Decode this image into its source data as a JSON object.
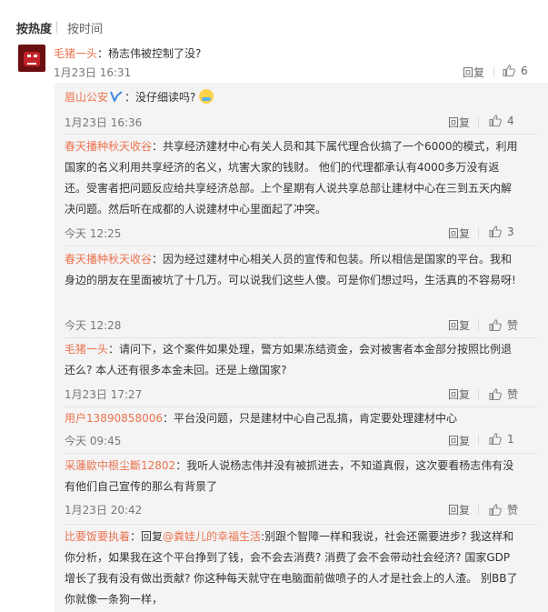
{
  "sort": {
    "hot": "按热度",
    "time": "按时间"
  },
  "top_comment": {
    "user": "毛猪一头",
    "text": "：杨志伟被控制了没?",
    "time": "1月23日 16:31",
    "reply": "回复",
    "likes": "6"
  },
  "replies": [
    {
      "user": "眉山公安",
      "text": "：没仔细读吗?",
      "time": "1月23日 16:36",
      "reply": "回复",
      "likes": "4"
    },
    {
      "user": "春天播种秋天收谷",
      "text": "：共享经济建材中心有关人员和其下属代理合伙搞了一个6000的模式，利用国家的名义利用共享经济的名义，坑害大家的钱财。 他们的代理都承认有4000多万没有返还。受害者把问题反应给共享经济总部。上个星期有人说共享总部让建材中心在三到五天内解决问题。然后听在成都的人说建材中心里面起了冲突。",
      "time": "今天 12:25",
      "reply": "回复",
      "likes": "3"
    },
    {
      "user": "春天播种秋天收谷",
      "text": "：因为经过建材中心相关人员的宣传和包装。所以相信是国家的平台。我和身边的朋友在里面被坑了十几万。可以说我们这些人傻。可是你们想过吗，生活真的不容易呀!",
      "time": "今天 12:28",
      "reply": "回复",
      "likes": "赞"
    },
    {
      "user": "毛猪一头",
      "text": "：请问下，这个案件如果处理，警方如果冻结资金，会对被害者本金部分按照比例退还么? 本人还有很多本金未回。还是上缴国家?",
      "time": "1月23日 17:27",
      "reply": "回复",
      "likes": "赞"
    },
    {
      "user": "用户13890858006",
      "text": "：平台没问题，只是建材中心自己乱搞，肯定要处理建材中心",
      "time": "今天 09:45",
      "reply": "回复",
      "likes": "1"
    },
    {
      "user": "采蓮歐中根尘斷12802",
      "text": "：我听人说杨志伟并没有被抓进去，不知道真假，这次要看杨志伟有没有他们自己宣传的那么有背景了",
      "time": "1月23日 20:42",
      "reply": "回复",
      "likes": "赞"
    },
    {
      "user": "比要饭要执着",
      "text_pre": "：回复",
      "mention": "@粪娃儿的幸福生活",
      "text": ":别跟个智障一样和我说，社会还需要进步?    我这样和你分析，如果我在这个平台挣到了钱，会不会去消费?   消费了会不会带动社会经济?     国家GDP增长了我有没有做出贡献?        你这种每天就守在电脑面前做喷子的人才是社会上的人渣。  别BB了  你就像一条狗一样，",
      "time": "",
      "reply": "",
      "likes": ""
    }
  ]
}
